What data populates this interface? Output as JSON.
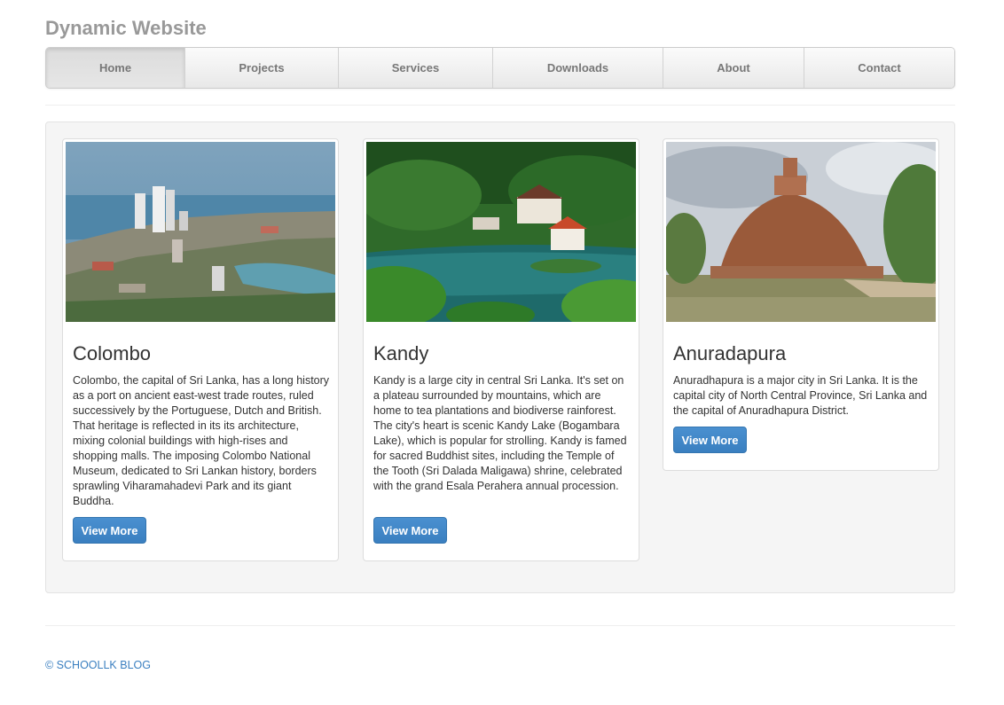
{
  "site": {
    "title": "Dynamic Website"
  },
  "nav": {
    "items": [
      {
        "label": "Home",
        "active": true
      },
      {
        "label": "Projects"
      },
      {
        "label": "Services"
      },
      {
        "label": "Downloads"
      },
      {
        "label": "About"
      },
      {
        "label": "Contact"
      }
    ]
  },
  "cards": [
    {
      "title": "Colombo",
      "text": "Colombo, the capital of Sri Lanka, has a long history as a port on ancient east-west trade routes, ruled successively by the Portuguese, Dutch and British. That heritage is reflected in its its architecture, mixing colonial buildings with high-rises and shopping malls. The imposing Colombo National Museum, dedicated to Sri Lankan history, borders sprawling Viharamahadevi Park and its giant Buddha.",
      "button": "View More"
    },
    {
      "title": "Kandy",
      "text": "Kandy is a large city in central Sri Lanka. It's set on a plateau surrounded by mountains, which are home to tea plantations and biodiverse rainforest. The city's heart is scenic Kandy Lake (Bogambara Lake), which is popular for strolling. Kandy is famed for sacred Buddhist sites, including the Temple of the Tooth (Sri Dalada Maligawa) shrine, celebrated with the grand Esala Perahera annual procession.",
      "button": "View More"
    },
    {
      "title": "Anuradapura",
      "text": "Anuradhapura is a major city in Sri Lanka. It is the capital city of North Central Province, Sri Lanka and the capital of Anuradhapura District.",
      "button": "View More"
    }
  ],
  "footer": {
    "text": "© SCHOOLLK BLOG"
  },
  "colors": {
    "accent": "#3a7fc0",
    "title": "#999999",
    "well": "#f5f5f5"
  }
}
